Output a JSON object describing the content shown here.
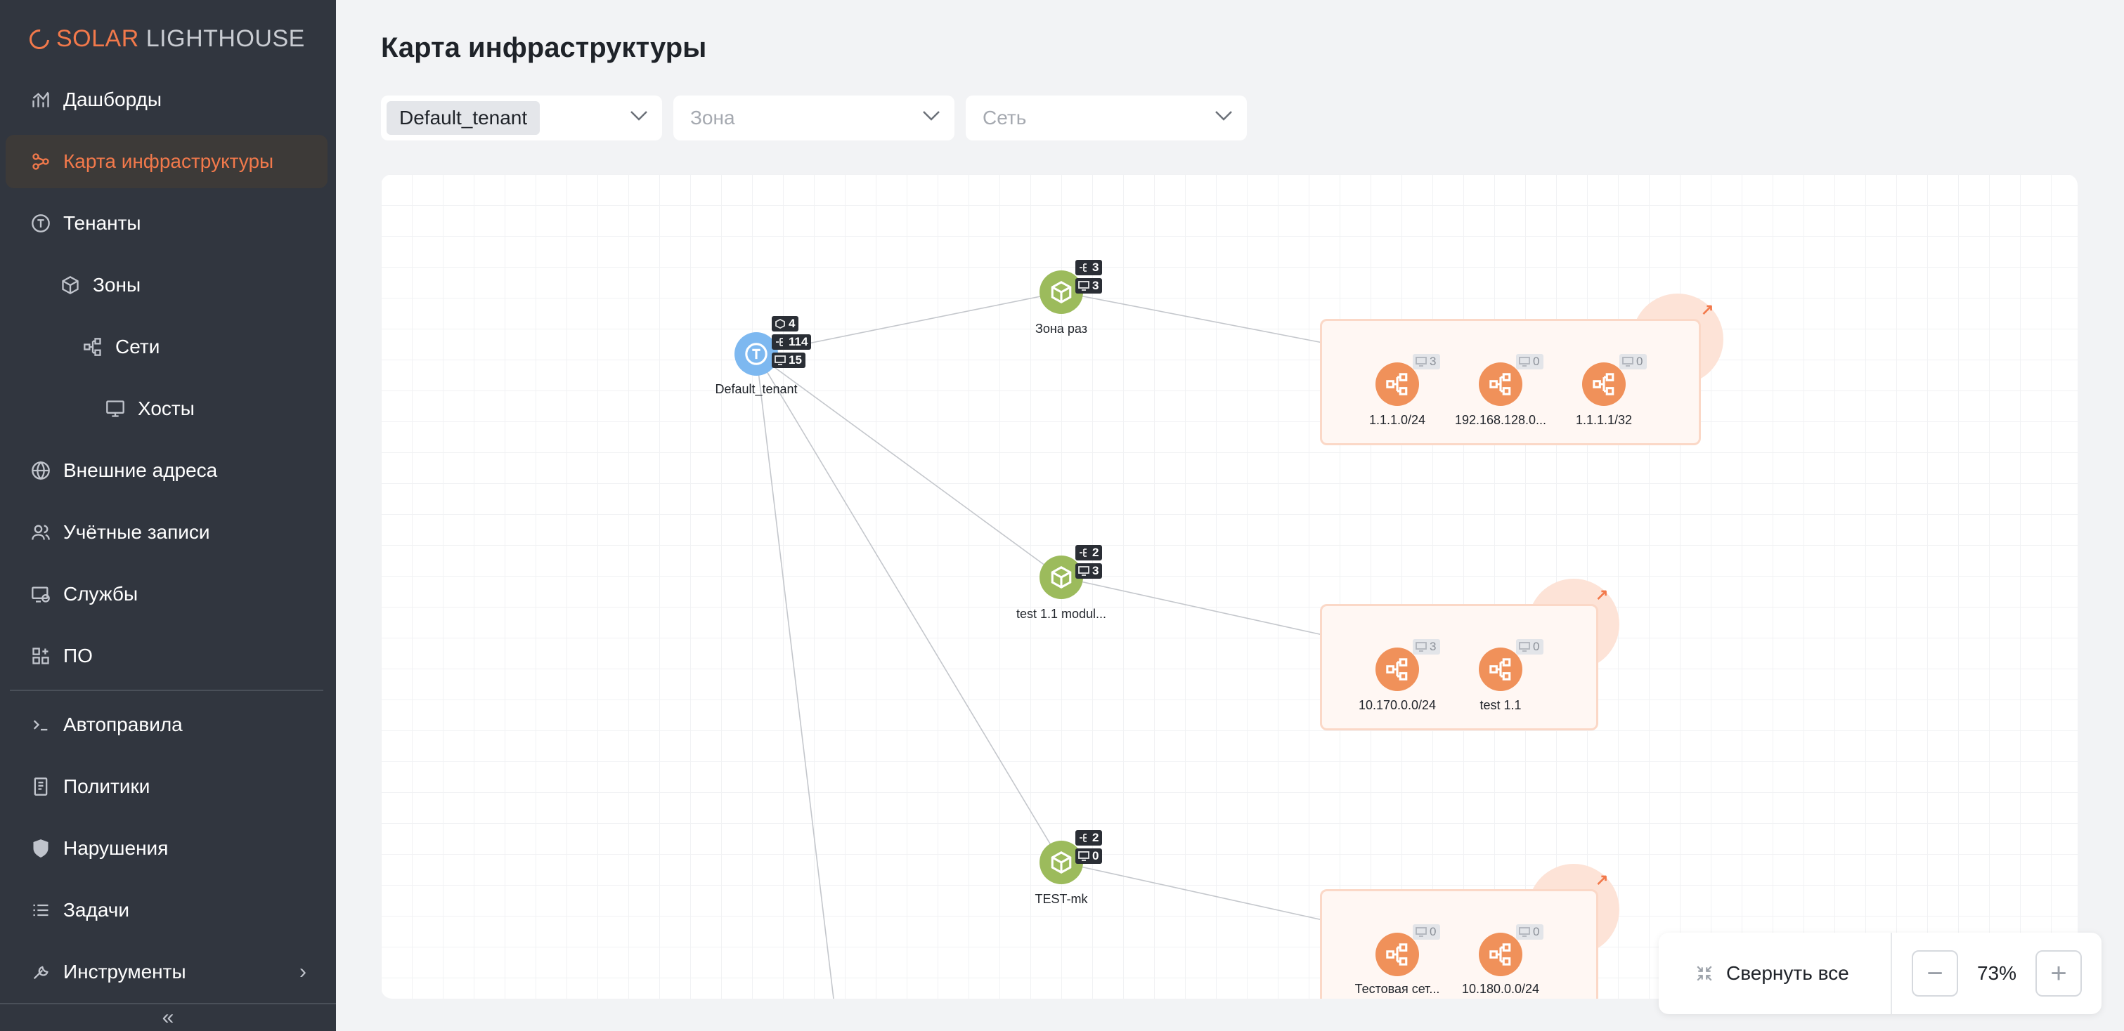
{
  "app": {
    "logo_part1": "SOLAR",
    "logo_part2": "LIGHTHOUSE"
  },
  "sidebar": {
    "items": [
      {
        "label": "Дашборды",
        "icon": "chart-icon"
      },
      {
        "label": "Карта инфраструктуры",
        "icon": "topology-icon",
        "active": true
      },
      {
        "label": "Тенанты",
        "icon": "tenant-icon"
      },
      {
        "label": "Зоны",
        "icon": "cube-icon"
      },
      {
        "label": "Сети",
        "icon": "network-icon"
      },
      {
        "label": "Хосты",
        "icon": "monitor-icon"
      },
      {
        "label": "Внешние адреса",
        "icon": "globe-icon"
      },
      {
        "label": "Учётные записи",
        "icon": "users-icon"
      },
      {
        "label": "Службы",
        "icon": "services-icon"
      },
      {
        "label": "ПО",
        "icon": "apps-icon"
      },
      {
        "label": "Автоправила",
        "icon": "terminal-icon"
      },
      {
        "label": "Политики",
        "icon": "document-icon"
      },
      {
        "label": "Нарушения",
        "icon": "shield-icon"
      },
      {
        "label": "Задачи",
        "icon": "list-icon"
      },
      {
        "label": "Инструменты",
        "icon": "wrench-icon"
      }
    ],
    "collapse_glyph": "«"
  },
  "main": {
    "title": "Карта инфраструктуры",
    "filters": {
      "tenant_value": "Default_tenant",
      "zone_placeholder": "Зона",
      "network_placeholder": "Сеть"
    }
  },
  "map": {
    "tenant": {
      "label": "Default_tenant",
      "badges": [
        "4",
        "114",
        "15"
      ]
    },
    "zones": [
      {
        "label": "Зона раз",
        "badges": [
          "3",
          "3"
        ]
      },
      {
        "label": "test 1.1 modul...",
        "badges": [
          "2",
          "3"
        ]
      },
      {
        "label": "TEST-mk",
        "badges": [
          "2",
          "0"
        ]
      }
    ],
    "networks": [
      {
        "label": "1.1.1.0/24",
        "hosts": "3"
      },
      {
        "label": "192.168.128.0...",
        "hosts": "0"
      },
      {
        "label": "1.1.1.1/32",
        "hosts": "0"
      },
      {
        "label": "10.170.0.0/24",
        "hosts": "3"
      },
      {
        "label": "test 1.1",
        "hosts": "0"
      },
      {
        "label": "Тестовая сет...",
        "hosts": "0"
      },
      {
        "label": "10.180.0.0/24",
        "hosts": "0"
      }
    ],
    "expand_glyph": "↗"
  },
  "zoom": {
    "collapse_all_label": "Свернуть все",
    "value": "73%",
    "minus": "−",
    "plus": "+"
  },
  "colors": {
    "accent": "#f2794b",
    "sidebar_bg": "#31363f",
    "tenant_node": "#7db8f0",
    "zone_node": "#9cbb5c",
    "network_node": "#f0915a"
  }
}
